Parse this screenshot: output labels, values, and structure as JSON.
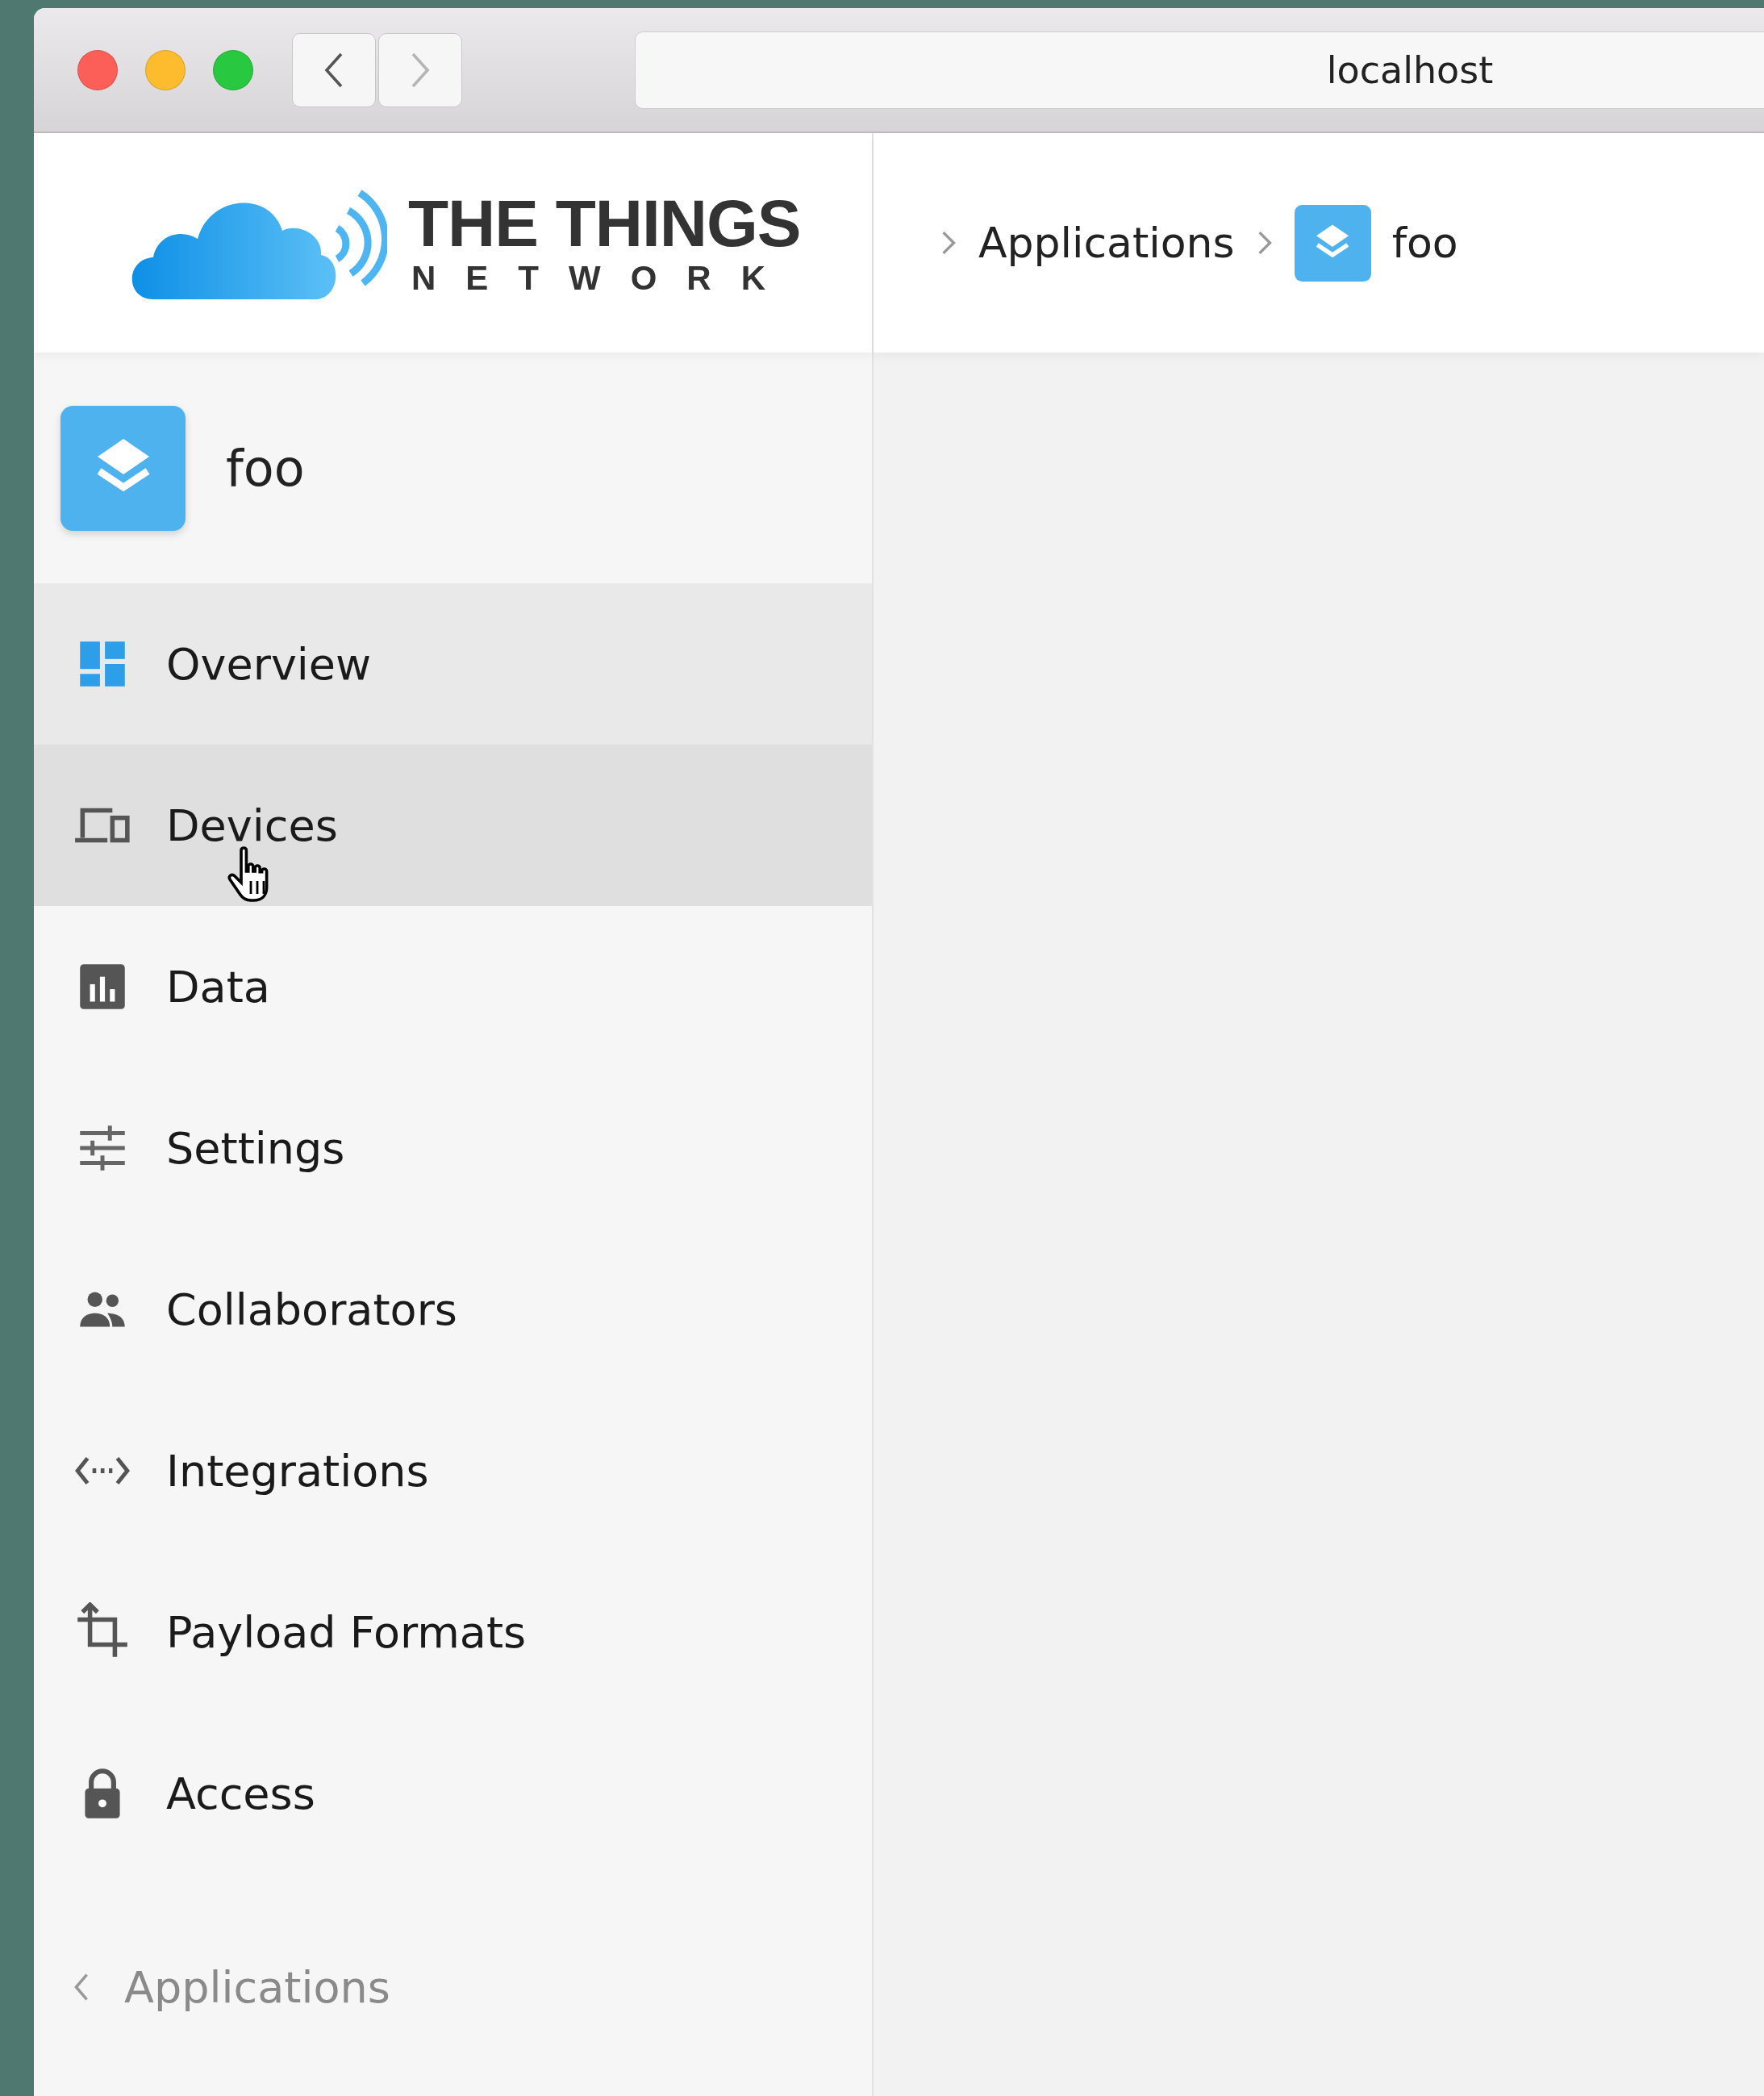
{
  "browser": {
    "url": "localhost"
  },
  "logo": {
    "title": "THE THINGS",
    "subtitle": "NETWORK"
  },
  "breadcrumbs": [
    {
      "label": "Applications",
      "kind": "text"
    },
    {
      "label": "foo",
      "kind": "app"
    }
  ],
  "sidebar": {
    "app_name": "foo",
    "items": [
      {
        "label": "Overview",
        "selected": true,
        "hovered": false
      },
      {
        "label": "Devices",
        "selected": false,
        "hovered": true
      },
      {
        "label": "Data",
        "selected": false,
        "hovered": false
      },
      {
        "label": "Settings",
        "selected": false,
        "hovered": false
      },
      {
        "label": "Collaborators",
        "selected": false,
        "hovered": false
      },
      {
        "label": "Integrations",
        "selected": false,
        "hovered": false
      },
      {
        "label": "Payload Formats",
        "selected": false,
        "hovered": false
      },
      {
        "label": "Access",
        "selected": false,
        "hovered": false
      }
    ],
    "back_link": "Applications"
  }
}
